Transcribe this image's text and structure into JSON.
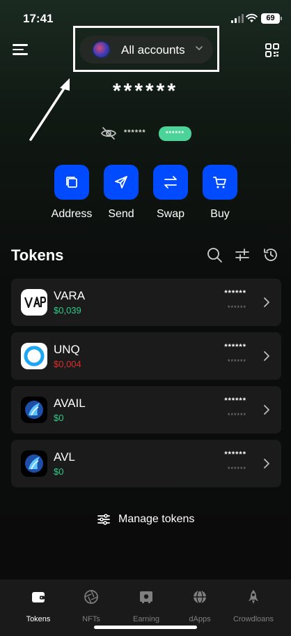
{
  "status_bar": {
    "time": "17:41",
    "battery": "69"
  },
  "header": {
    "account_selector_label": "All accounts",
    "balance_masked": "******",
    "hidden_balance_masked": "******",
    "hidden_badge_masked": "******"
  },
  "actions": [
    {
      "label": "Address",
      "icon": "copy-icon"
    },
    {
      "label": "Send",
      "icon": "send-icon"
    },
    {
      "label": "Swap",
      "icon": "swap-icon"
    },
    {
      "label": "Buy",
      "icon": "cart-icon"
    }
  ],
  "tokens_section": {
    "title": "Tokens"
  },
  "tokens": [
    {
      "name": "VARA",
      "price": "$0,039",
      "price_color": "#2ecc88",
      "balance": "******",
      "value": "******"
    },
    {
      "name": "UNQ",
      "price": "$0,004",
      "price_color": "#e02c2c",
      "balance": "******",
      "value": "******"
    },
    {
      "name": "AVAIL",
      "price": "$0",
      "price_color": "#2ecc88",
      "balance": "******",
      "value": "******"
    },
    {
      "name": "AVL",
      "price": "$0",
      "price_color": "#2ecc88",
      "balance": "******",
      "value": "******"
    }
  ],
  "manage_tokens": {
    "label": "Manage tokens"
  },
  "bottom_nav": [
    {
      "label": "Tokens",
      "icon": "wallet-icon",
      "active": true
    },
    {
      "label": "NFTs",
      "icon": "aperture-icon",
      "active": false
    },
    {
      "label": "Earning",
      "icon": "safe-icon",
      "active": false
    },
    {
      "label": "dApps",
      "icon": "globe-icon",
      "active": false
    },
    {
      "label": "Crowdloans",
      "icon": "rocket-icon",
      "active": false
    }
  ],
  "colors": {
    "accent": "#004bff",
    "positive": "#2ecc88",
    "negative": "#e02c2c",
    "badge": "#4cd39a"
  }
}
